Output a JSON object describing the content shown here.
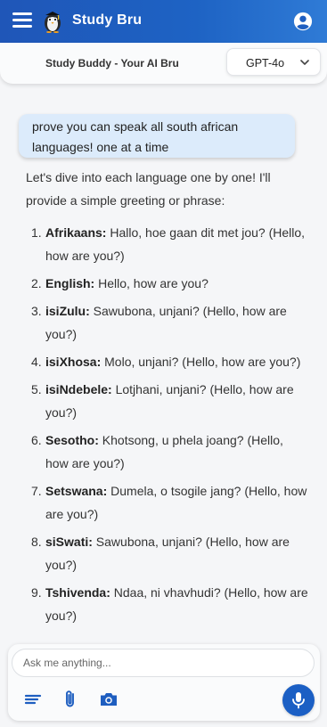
{
  "app": {
    "title": "Study Bru"
  },
  "header": {
    "subtitle": "Study Buddy - Your AI Bru",
    "model": "GPT-4o"
  },
  "icons": {
    "menu": "menu-icon",
    "logo": "study-bru-logo-icon",
    "account": "account-circle-icon",
    "chevron": "chevron-down-icon",
    "notes": "notes-icon",
    "attach": "paperclip-icon",
    "camera": "camera-icon",
    "mic": "microphone-icon"
  },
  "colors": {
    "accent": "#1e63c4",
    "user_bubble": "#dcebfb"
  },
  "chat": {
    "user_message": "prove you can speak all south african languages! one at a time",
    "reply_intro": "Let's dive into each language one by one! I'll provide a simple greeting or phrase:",
    "items": [
      {
        "num": "1.",
        "lang": "Afrikaans:",
        "text": "Hallo, hoe gaan dit met jou? (Hello, how are you?)"
      },
      {
        "num": "2.",
        "lang": "English:",
        "text": "Hello, how are you?"
      },
      {
        "num": "3.",
        "lang": "isiZulu:",
        "text": "Sawubona, unjani? (Hello, how are you?)"
      },
      {
        "num": "4.",
        "lang": "isiXhosa:",
        "text": "Molo, unjani? (Hello, how are you?)"
      },
      {
        "num": "5.",
        "lang": "isiNdebele:",
        "text": "Lotjhani, unjani? (Hello, how are you?)"
      },
      {
        "num": "6.",
        "lang": "Sesotho:",
        "text": "Khotsong, u phela joang? (Hello, how are you?)"
      },
      {
        "num": "7.",
        "lang": "Setswana:",
        "text": "Dumela, o tsogile jang? (Hello, how are you?)"
      },
      {
        "num": "8.",
        "lang": "siSwati:",
        "text": "Sawubona, unjani? (Hello, how are you?)"
      },
      {
        "num": "9.",
        "lang": "Tshivenda:",
        "text": "Ndaa, ni vhavhudi? (Hello, how are you?)"
      }
    ]
  },
  "composer": {
    "placeholder": "Ask me anything...",
    "value": ""
  }
}
